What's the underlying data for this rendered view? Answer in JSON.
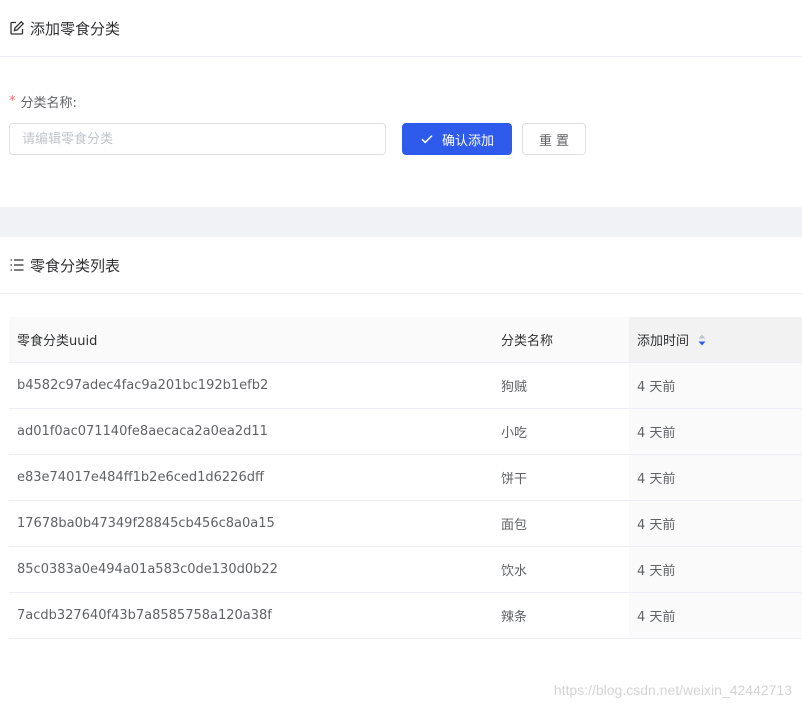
{
  "add_card": {
    "title": "添加零食分类",
    "form": {
      "required_mark": "*",
      "label": "分类名称:",
      "input_value": "",
      "input_placeholder": "请编辑零食分类",
      "confirm_label": "确认添加",
      "reset_label": "重置"
    }
  },
  "list_card": {
    "title": "零食分类列表",
    "columns": [
      "零食分类uuid",
      "分类名称",
      "添加时间"
    ],
    "rows": [
      {
        "uuid": "b4582c97adec4fac9a201bc192b1efb2",
        "name": "狗贼",
        "time": "4 天前"
      },
      {
        "uuid": "ad01f0ac071140fe8aecaca2a0ea2d11",
        "name": "小吃",
        "time": "4 天前"
      },
      {
        "uuid": "e83e74017e484ff1b2e6ced1d6226dff",
        "name": "饼干",
        "time": "4 天前"
      },
      {
        "uuid": "17678ba0b47349f28845cb456c8a0a15",
        "name": "面包",
        "time": "4 天前"
      },
      {
        "uuid": "85c0383a0e494a01a583c0de130d0b22",
        "name": "饮水",
        "time": "4 天前"
      },
      {
        "uuid": "7acdb327640f43b7a8585758a120a38f",
        "name": "辣条",
        "time": "4 天前"
      }
    ]
  },
  "watermark": "https://blog.csdn.net/weixin_42442713",
  "colors": {
    "primary": "#2e5bec",
    "required": "#f56c6c",
    "band": "#f0f2f5",
    "border": "#ebeef5"
  },
  "icons": {
    "add_header": "edit-icon",
    "list_header": "list-icon",
    "confirm": "check-icon",
    "sort": "sort-icon"
  }
}
